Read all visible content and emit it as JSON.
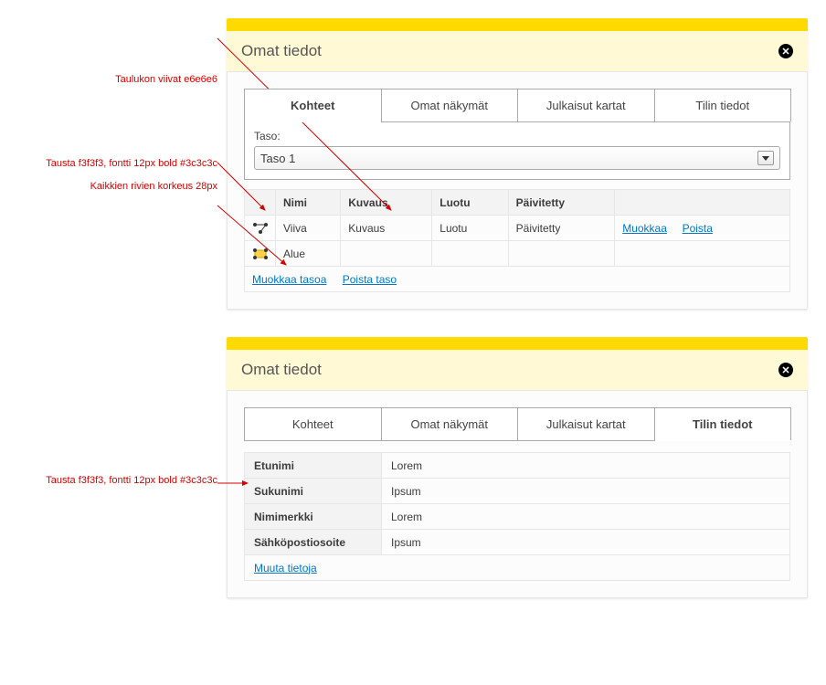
{
  "annotations": {
    "panel1": {
      "line_color": "Taulukon viivat e6e6e6",
      "header_style": "Tausta f3f3f3, fontti 12px bold #3c3c3c",
      "row_height": "Kaikkien rivien korkeus 28px"
    },
    "panel2": {
      "header_style": "Tausta f3f3f3, fontti 12px bold #3c3c3c"
    }
  },
  "colors": {
    "accent_yellow": "#ffda00",
    "table_line": "#e6e6e6",
    "header_bg": "#f3f3f3",
    "header_text": "#3c3c3c",
    "link": "#0078c8"
  },
  "panels": [
    {
      "title": "Omat tiedot",
      "tabs": [
        "Kohteet",
        "Omat näkymät",
        "Julkaisut kartat",
        "Tilin tiedot"
      ],
      "active_tab_index": 0,
      "level": {
        "label": "Taso:",
        "selected": "Taso 1"
      },
      "table": {
        "columns": [
          "",
          "Nimi",
          "Kuvaus",
          "Luotu",
          "Päivitetty",
          ""
        ],
        "rows": [
          {
            "icon": "line",
            "nimi": "Viiva",
            "kuvaus": "Kuvaus",
            "luotu": "Luotu",
            "paivitetty": "Päivitetty",
            "edit": "Muokkaa",
            "del": "Poista"
          },
          {
            "icon": "area",
            "nimi": "Alue",
            "kuvaus": "",
            "luotu": "",
            "paivitetty": "",
            "edit": "",
            "del": ""
          }
        ],
        "footer": {
          "edit_level": "Muokkaa tasoa",
          "delete_level": "Poista taso"
        }
      }
    },
    {
      "title": "Omat tiedot",
      "tabs": [
        "Kohteet",
        "Omat näkymät",
        "Julkaisut kartat",
        "Tilin tiedot"
      ],
      "active_tab_index": 3,
      "account": {
        "fields": [
          {
            "label": "Etunimi",
            "value": "Lorem"
          },
          {
            "label": "Sukunimi",
            "value": "Ipsum"
          },
          {
            "label": "Nimimerkki",
            "value": "Lorem"
          },
          {
            "label": "Sähköpostiosoite",
            "value": "Ipsum"
          }
        ],
        "footer": "Muuta tietoja"
      }
    }
  ],
  "tab_labels": {
    "kohteet": "Kohteet",
    "omat_nakymat": "Omat näkymät",
    "julkaisut_kartat": "Julkaisut kartat",
    "tilin_tiedot": "Tilin tiedot"
  }
}
